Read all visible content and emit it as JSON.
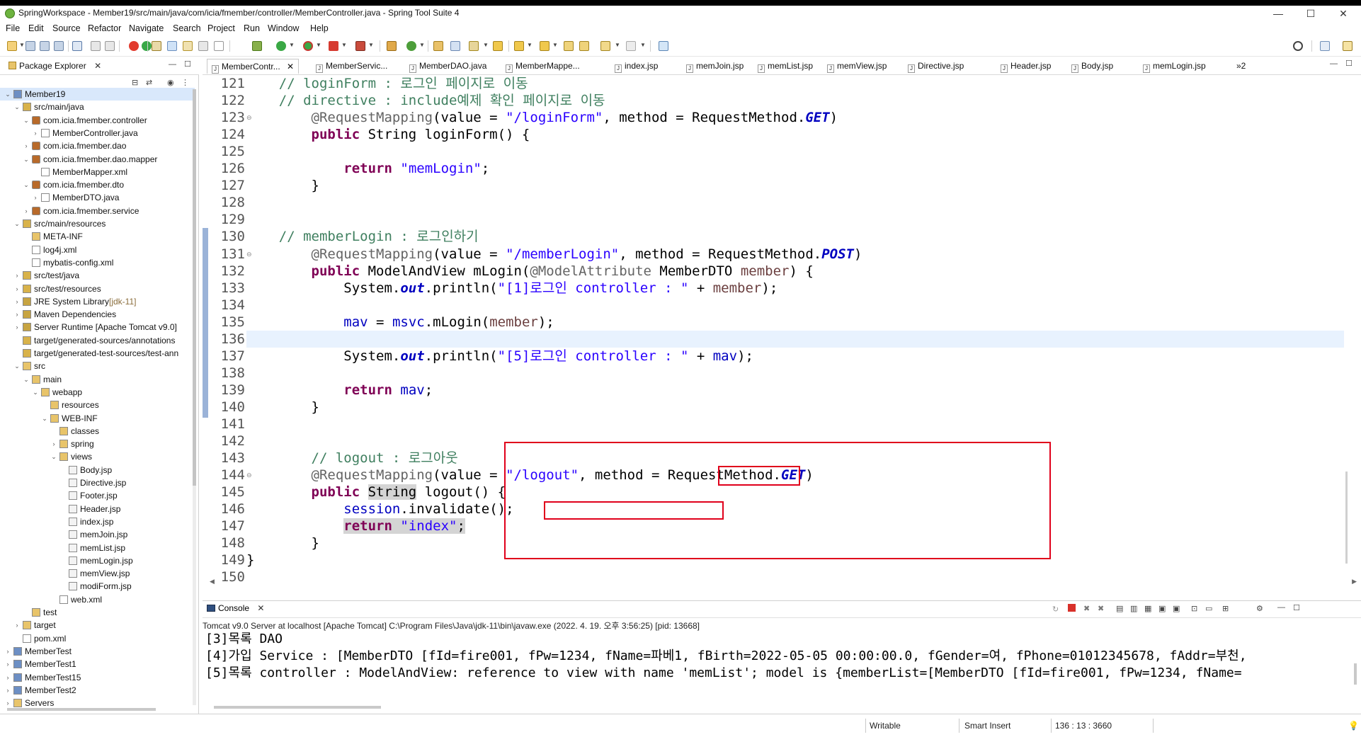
{
  "window": {
    "title": "SpringWorkspace - Member19/src/main/java/com/icia/fmember/controller/MemberController.java - Spring Tool Suite 4",
    "controls": {
      "minimize": "—",
      "maximize": "☐",
      "close": "✕"
    }
  },
  "menubar": [
    "File",
    "Edit",
    "Source",
    "Refactor",
    "Navigate",
    "Search",
    "Project",
    "Run",
    "Window",
    "Help"
  ],
  "package_explorer": {
    "tab_label": "Package Explorer",
    "tree": [
      {
        "label": "Member19",
        "depth": 0,
        "twisty": "open",
        "icon": "project-icon",
        "selected": true
      },
      {
        "label": "src/main/java",
        "depth": 1,
        "twisty": "open",
        "icon": "source-folder-icon"
      },
      {
        "label": "com.icia.fmember.controller",
        "depth": 2,
        "twisty": "open",
        "icon": "package-icon"
      },
      {
        "label": "MemberController.java",
        "depth": 3,
        "twisty": "closed",
        "icon": "java-file-icon"
      },
      {
        "label": "com.icia.fmember.dao",
        "depth": 2,
        "twisty": "closed",
        "icon": "package-icon"
      },
      {
        "label": "com.icia.fmember.dao.mapper",
        "depth": 2,
        "twisty": "open",
        "icon": "package-icon"
      },
      {
        "label": "MemberMapper.xml",
        "depth": 3,
        "twisty": "",
        "icon": "xml-file-icon"
      },
      {
        "label": "com.icia.fmember.dto",
        "depth": 2,
        "twisty": "open",
        "icon": "package-icon"
      },
      {
        "label": "MemberDTO.java",
        "depth": 3,
        "twisty": "closed",
        "icon": "java-file-icon"
      },
      {
        "label": "com.icia.fmember.service",
        "depth": 2,
        "twisty": "closed",
        "icon": "package-icon"
      },
      {
        "label": "src/main/resources",
        "depth": 1,
        "twisty": "open",
        "icon": "source-folder-icon"
      },
      {
        "label": "META-INF",
        "depth": 2,
        "twisty": "",
        "icon": "folder-icon"
      },
      {
        "label": "log4j.xml",
        "depth": 2,
        "twisty": "",
        "icon": "xml-file-icon"
      },
      {
        "label": "mybatis-config.xml",
        "depth": 2,
        "twisty": "",
        "icon": "xml-file-icon"
      },
      {
        "label": "src/test/java",
        "depth": 1,
        "twisty": "closed",
        "icon": "source-folder-icon"
      },
      {
        "label": "src/test/resources",
        "depth": 1,
        "twisty": "closed",
        "icon": "source-folder-icon"
      },
      {
        "label": "JRE System Library",
        "decoration": "[jdk-11]",
        "depth": 1,
        "twisty": "closed",
        "icon": "library-icon"
      },
      {
        "label": "Maven Dependencies",
        "depth": 1,
        "twisty": "closed",
        "icon": "library-icon"
      },
      {
        "label": "Server Runtime [Apache Tomcat v9.0]",
        "depth": 1,
        "twisty": "closed",
        "icon": "library-icon"
      },
      {
        "label": "target/generated-sources/annotations",
        "depth": 1,
        "twisty": "",
        "icon": "source-folder-icon"
      },
      {
        "label": "target/generated-test-sources/test-ann",
        "depth": 1,
        "twisty": "",
        "icon": "source-folder-icon"
      },
      {
        "label": "src",
        "depth": 1,
        "twisty": "open",
        "icon": "folder-icon"
      },
      {
        "label": "main",
        "depth": 2,
        "twisty": "open",
        "icon": "folder-icon"
      },
      {
        "label": "webapp",
        "depth": 3,
        "twisty": "open",
        "icon": "folder-icon"
      },
      {
        "label": "resources",
        "depth": 4,
        "twisty": "",
        "icon": "folder-icon"
      },
      {
        "label": "WEB-INF",
        "depth": 4,
        "twisty": "open",
        "icon": "folder-icon"
      },
      {
        "label": "classes",
        "depth": 5,
        "twisty": "",
        "icon": "folder-icon"
      },
      {
        "label": "spring",
        "depth": 5,
        "twisty": "closed",
        "icon": "folder-icon"
      },
      {
        "label": "views",
        "depth": 5,
        "twisty": "open",
        "icon": "folder-icon"
      },
      {
        "label": "Body.jsp",
        "depth": 6,
        "twisty": "",
        "icon": "jsp-file-icon"
      },
      {
        "label": "Directive.jsp",
        "depth": 6,
        "twisty": "",
        "icon": "jsp-file-icon"
      },
      {
        "label": "Footer.jsp",
        "depth": 6,
        "twisty": "",
        "icon": "jsp-file-icon"
      },
      {
        "label": "Header.jsp",
        "depth": 6,
        "twisty": "",
        "icon": "jsp-file-icon"
      },
      {
        "label": "index.jsp",
        "depth": 6,
        "twisty": "",
        "icon": "jsp-file-icon"
      },
      {
        "label": "memJoin.jsp",
        "depth": 6,
        "twisty": "",
        "icon": "jsp-file-icon"
      },
      {
        "label": "memList.jsp",
        "depth": 6,
        "twisty": "",
        "icon": "jsp-file-icon"
      },
      {
        "label": "memLogin.jsp",
        "depth": 6,
        "twisty": "",
        "icon": "jsp-file-icon"
      },
      {
        "label": "memView.jsp",
        "depth": 6,
        "twisty": "",
        "icon": "jsp-file-icon"
      },
      {
        "label": "modiForm.jsp",
        "depth": 6,
        "twisty": "",
        "icon": "jsp-file-icon"
      },
      {
        "label": "web.xml",
        "depth": 5,
        "twisty": "",
        "icon": "xml-file-icon"
      },
      {
        "label": "test",
        "depth": 2,
        "twisty": "",
        "icon": "folder-icon"
      },
      {
        "label": "target",
        "depth": 1,
        "twisty": "closed",
        "icon": "folder-icon"
      },
      {
        "label": "pom.xml",
        "depth": 1,
        "twisty": "",
        "icon": "xml-file-icon"
      },
      {
        "label": "MemberTest",
        "depth": 0,
        "twisty": "closed",
        "icon": "project-icon"
      },
      {
        "label": "MemberTest1",
        "depth": 0,
        "twisty": "closed",
        "icon": "project-icon"
      },
      {
        "label": "MemberTest15",
        "depth": 0,
        "twisty": "closed",
        "icon": "project-icon"
      },
      {
        "label": "MemberTest2",
        "depth": 0,
        "twisty": "closed",
        "icon": "project-icon"
      },
      {
        "label": "Servers",
        "depth": 0,
        "twisty": "closed",
        "icon": "folder-icon"
      }
    ]
  },
  "editor_tabs": [
    {
      "label": "MemberContr...",
      "active": true
    },
    {
      "label": "MemberServic..."
    },
    {
      "label": "MemberDAO.java"
    },
    {
      "label": "MemberMappe..."
    },
    {
      "label": "index.jsp"
    },
    {
      "label": "memJoin.jsp"
    },
    {
      "label": "memList.jsp"
    },
    {
      "label": "memView.jsp"
    },
    {
      "label": "Directive.jsp"
    },
    {
      "label": "Header.jsp"
    },
    {
      "label": "Body.jsp"
    },
    {
      "label": "memLogin.jsp"
    }
  ],
  "editor_tabs_overflow": "»2",
  "code_lines": [
    {
      "n": "121",
      "fold": "",
      "tokens": [
        [
          "    ",
          ""
        ],
        [
          "// loginForm : 로그인 페이지로 이동",
          "cm"
        ]
      ]
    },
    {
      "n": "122",
      "fold": "",
      "tokens": [
        [
          "    ",
          ""
        ],
        [
          "// directive : include예제 확인 페이지로 이동",
          "cm"
        ]
      ]
    },
    {
      "n": "123",
      "fold": "⊖",
      "tokens": [
        [
          "        ",
          ""
        ],
        [
          "@RequestMapping",
          "ann"
        ],
        [
          "(value = ",
          ""
        ],
        [
          "\"/loginForm\"",
          "str"
        ],
        [
          ", method = RequestMethod.",
          ""
        ],
        [
          "GET",
          "sfld"
        ],
        [
          ")",
          ""
        ]
      ]
    },
    {
      "n": "124",
      "fold": "",
      "tokens": [
        [
          "        ",
          ""
        ],
        [
          "public",
          "kw"
        ],
        [
          " String loginForm() {",
          ""
        ]
      ]
    },
    {
      "n": "125",
      "fold": "",
      "tokens": [
        [
          "",
          ""
        ]
      ]
    },
    {
      "n": "126",
      "fold": "",
      "tokens": [
        [
          "            ",
          ""
        ],
        [
          "return",
          "kw"
        ],
        [
          " ",
          ""
        ],
        [
          "\"memLogin\"",
          "str"
        ],
        [
          ";",
          ""
        ]
      ]
    },
    {
      "n": "127",
      "fold": "",
      "tokens": [
        [
          "        }",
          ""
        ]
      ]
    },
    {
      "n": "128",
      "fold": "",
      "tokens": [
        [
          "",
          ""
        ]
      ]
    },
    {
      "n": "129",
      "fold": "",
      "tokens": [
        [
          "",
          ""
        ]
      ]
    },
    {
      "n": "130",
      "fold": "",
      "tokens": [
        [
          "    ",
          ""
        ],
        [
          "// memberLogin : 로그인하기",
          "cm"
        ]
      ]
    },
    {
      "n": "131",
      "fold": "⊖",
      "tokens": [
        [
          "        ",
          ""
        ],
        [
          "@RequestMapping",
          "ann"
        ],
        [
          "(value = ",
          ""
        ],
        [
          "\"/memberLogin\"",
          "str"
        ],
        [
          ", method = RequestMethod.",
          ""
        ],
        [
          "POST",
          "sfld"
        ],
        [
          ")",
          ""
        ]
      ]
    },
    {
      "n": "132",
      "fold": "",
      "tokens": [
        [
          "        ",
          ""
        ],
        [
          "public",
          "kw"
        ],
        [
          " ModelAndView mLogin(",
          ""
        ],
        [
          "@ModelAttribute",
          "ann"
        ],
        [
          " MemberDTO ",
          ""
        ],
        [
          "member",
          "par"
        ],
        [
          ") {",
          ""
        ]
      ]
    },
    {
      "n": "133",
      "fold": "",
      "tokens": [
        [
          "            System.",
          ""
        ],
        [
          "out",
          "sfld"
        ],
        [
          ".println(",
          ""
        ],
        [
          "\"[1]로그인 controller : \"",
          "str"
        ],
        [
          " + ",
          ""
        ],
        [
          "member",
          "par"
        ],
        [
          ");",
          ""
        ]
      ]
    },
    {
      "n": "134",
      "fold": "",
      "tokens": [
        [
          "",
          ""
        ]
      ]
    },
    {
      "n": "135",
      "fold": "",
      "tokens": [
        [
          "            ",
          ""
        ],
        [
          "mav",
          "fld"
        ],
        [
          " = ",
          ""
        ],
        [
          "msvc",
          "fld"
        ],
        [
          ".mLogin(",
          ""
        ],
        [
          "member",
          "par"
        ],
        [
          ");",
          ""
        ]
      ]
    },
    {
      "n": "136",
      "fold": "",
      "tokens": [
        [
          "",
          ""
        ]
      ],
      "current": true
    },
    {
      "n": "137",
      "fold": "",
      "tokens": [
        [
          "            System.",
          ""
        ],
        [
          "out",
          "sfld"
        ],
        [
          ".println(",
          ""
        ],
        [
          "\"[5]로그인 controller : \"",
          "str"
        ],
        [
          " + ",
          ""
        ],
        [
          "mav",
          "fld"
        ],
        [
          ");",
          ""
        ]
      ]
    },
    {
      "n": "138",
      "fold": "",
      "tokens": [
        [
          "",
          ""
        ]
      ]
    },
    {
      "n": "139",
      "fold": "",
      "tokens": [
        [
          "            ",
          ""
        ],
        [
          "return",
          "kw"
        ],
        [
          " ",
          ""
        ],
        [
          "mav",
          "fld"
        ],
        [
          ";",
          ""
        ]
      ]
    },
    {
      "n": "140",
      "fold": "",
      "tokens": [
        [
          "        }",
          ""
        ]
      ]
    },
    {
      "n": "141",
      "fold": "",
      "tokens": [
        [
          "",
          ""
        ]
      ]
    },
    {
      "n": "142",
      "fold": "",
      "tokens": [
        [
          "",
          ""
        ]
      ]
    },
    {
      "n": "143",
      "fold": "",
      "tokens": [
        [
          "        ",
          ""
        ],
        [
          "// logout : 로그아웃",
          "cm"
        ]
      ]
    },
    {
      "n": "144",
      "fold": "⊖",
      "tokens": [
        [
          "        ",
          ""
        ],
        [
          "@RequestMapping",
          "ann"
        ],
        [
          "(value = ",
          ""
        ],
        [
          "\"/logout\"",
          "str"
        ],
        [
          ", method = RequestMethod.",
          ""
        ],
        [
          "GET",
          "sfld"
        ],
        [
          ")",
          ""
        ]
      ]
    },
    {
      "n": "145",
      "fold": "",
      "tokens": [
        [
          "        ",
          ""
        ],
        [
          "public",
          "kw"
        ],
        [
          " ",
          ""
        ],
        [
          "String",
          "hl"
        ],
        [
          " logout() {",
          ""
        ]
      ]
    },
    {
      "n": "146",
      "fold": "",
      "tokens": [
        [
          "            ",
          ""
        ],
        [
          "session",
          "fld"
        ],
        [
          ".invalidate();",
          ""
        ]
      ]
    },
    {
      "n": "147",
      "fold": "",
      "tokens": [
        [
          "            ",
          ""
        ],
        [
          "return",
          "kw hl"
        ],
        [
          " ",
          "hl"
        ],
        [
          "\"index\"",
          "str hl"
        ],
        [
          ";",
          "hl"
        ]
      ]
    },
    {
      "n": "148",
      "fold": "",
      "tokens": [
        [
          "        }",
          ""
        ]
      ]
    },
    {
      "n": "149",
      "fold": "",
      "tokens": [
        [
          "}",
          ""
        ]
      ]
    },
    {
      "n": "150",
      "fold": "",
      "tokens": [
        [
          "",
          ""
        ]
      ]
    }
  ],
  "console": {
    "tab_label": "Console",
    "description": "Tomcat v9.0 Server at localhost [Apache Tomcat] C:\\Program Files\\Java\\jdk-11\\bin\\javaw.exe  (2022. 4. 19. 오후 3:56:25) [pid: 13668]",
    "lines": [
      "[3]목록 DAO",
      "[4]가입 Service : [MemberDTO [fId=fire001, fPw=1234, fName=파베1, fBirth=2022-05-05 00:00:00.0, fGender=여, fPhone=01012345678, fAddr=부천,",
      "[5]목록 controller : ModelAndView: reference to view with name 'memList'; model is {memberList=[MemberDTO [fId=fire001, fPw=1234, fName="
    ]
  },
  "statusbar": {
    "mode": "Writable",
    "insert": "Smart Insert",
    "position": "136 : 13 : 3660"
  },
  "colors": {
    "keyword": "#7f0055",
    "string": "#2a00ff",
    "comment": "#3f7f5f",
    "annotation_box": "#e0001b",
    "current_line": "#e8f2fe"
  }
}
